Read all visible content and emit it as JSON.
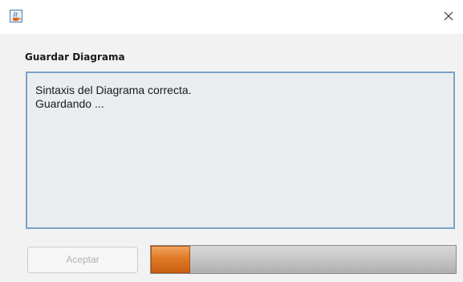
{
  "window": {
    "icon": "java-cup-icon",
    "close_icon": "close-icon"
  },
  "dialog": {
    "heading": "Guardar Diagrama",
    "message_lines": [
      "Sintaxis del Diagrama correcta.",
      "Guardando ..."
    ],
    "accept_button_label": "Aceptar",
    "accept_button_enabled": false,
    "progress_fraction": 0.13
  },
  "colors": {
    "progress_fill": "#e07a26",
    "text_area_border": "#7ca1c4"
  }
}
